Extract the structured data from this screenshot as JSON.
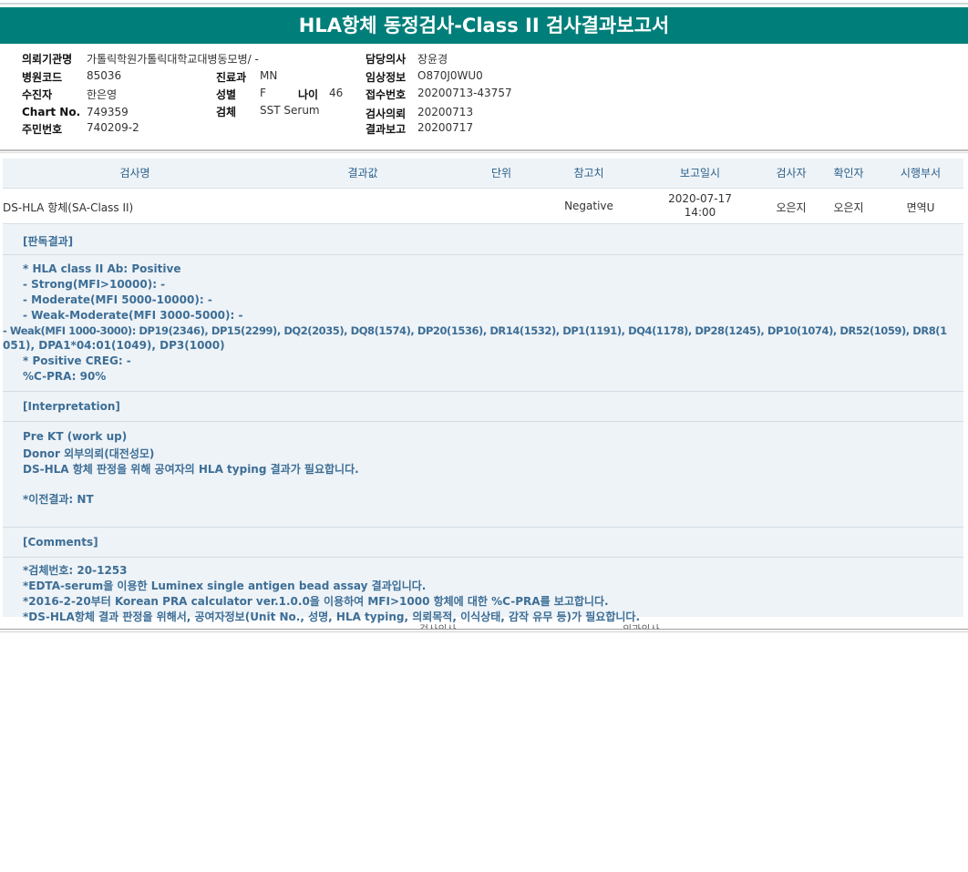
{
  "report": {
    "title": "HLA항체 동정검사-Class II 검사결과보고서"
  },
  "patient": {
    "hospital_label": "의뢰기관명",
    "hospital_value": "가톨릭학원가톨릭대학교대병동모병/ -",
    "code_label": "병원코드",
    "code_value": "85036",
    "collector_label": "수진자",
    "collector_value": "한은영",
    "chart_label": "Chart No.",
    "chart_value": "749359",
    "id_label": "주민번호",
    "id_value": "740209-2",
    "dept_label": "진료과",
    "dept_value": "MN",
    "sex_label": "성별",
    "sex_value": "F",
    "age_label": "나이",
    "age_value": "46",
    "specimen_label": "검체",
    "specimen_value": "SST Serum",
    "doctor_label": "담당의사",
    "doctor_value": "장윤경",
    "clinical_label": "임상정보",
    "clinical_value": "O870J0WU0",
    "receipt_label": "접수번호",
    "receipt_value": "20200713-43757",
    "request_label": "검사의뢰",
    "request_value": "20200713",
    "report_label": "결과보고",
    "report_value": "20200717"
  },
  "table": {
    "headers": {
      "test": "검사명",
      "result": "결과값",
      "unit": "단위",
      "reference": "참고치",
      "report_date": "보고일시",
      "tester": "검사자",
      "confirmer": "확인자",
      "dept": "시행부서"
    },
    "row": {
      "test": "DS-HLA 항체(SA-Class II)",
      "reference": "Negative",
      "date": "2020-07-17",
      "time": "14:00",
      "tester": "오은지",
      "confirmer": "오은지",
      "dept": "면역U"
    }
  },
  "reading": {
    "title": "[판독결과]",
    "lines": [
      "* HLA class II Ab: Positive",
      "- Strong(MFI>10000): -",
      "- Moderate(MFI 5000-10000): -",
      "- Weak-Moderate(MFI 3000-5000): -",
      "- Weak(MFI 1000-3000): DP19(2346), DP15(2299), DQ2(2035), DQ8(1574), DP20(1536), DR14(1532), DP1(1191), DQ4(1178), DP28(1245), DP10(1074), DR52(1059), DR8(1",
      "051), DPA1*04:01(1049), DP3(1000)",
      "* Positive CREG: -",
      " %C-PRA: 90%"
    ]
  },
  "interpretation": {
    "title": "[Interpretation]",
    "lines": [
      "Pre KT (work up)",
      "Donor 외부의뢰(대전성모)",
      "DS-HLA 항체 판정을 위해 공여자의 HLA typing 결과가 필요합니다.",
      "*이전결과: NT"
    ]
  },
  "comments": {
    "title": "[Comments]",
    "lines": [
      "*검체번호: 20-1253",
      "*EDTA-serum을 이용한 Luminex single antigen bead assay 결과입니다.",
      "*2016-2-20부터 Korean PRA calculator ver.1.0.0을 이용하여 MFI>1000 항체에 대한 %C-PRA를 보고합니다.",
      "*DS-HLA항체 결과 판정을 위해서, 공여자정보(Unit No., 성명, HLA typing, 의뢰목적, 이식상태, 감작 유무 등)가 필요합니다."
    ]
  },
  "footer": {
    "left": "검사의사",
    "right": "의과의사"
  }
}
